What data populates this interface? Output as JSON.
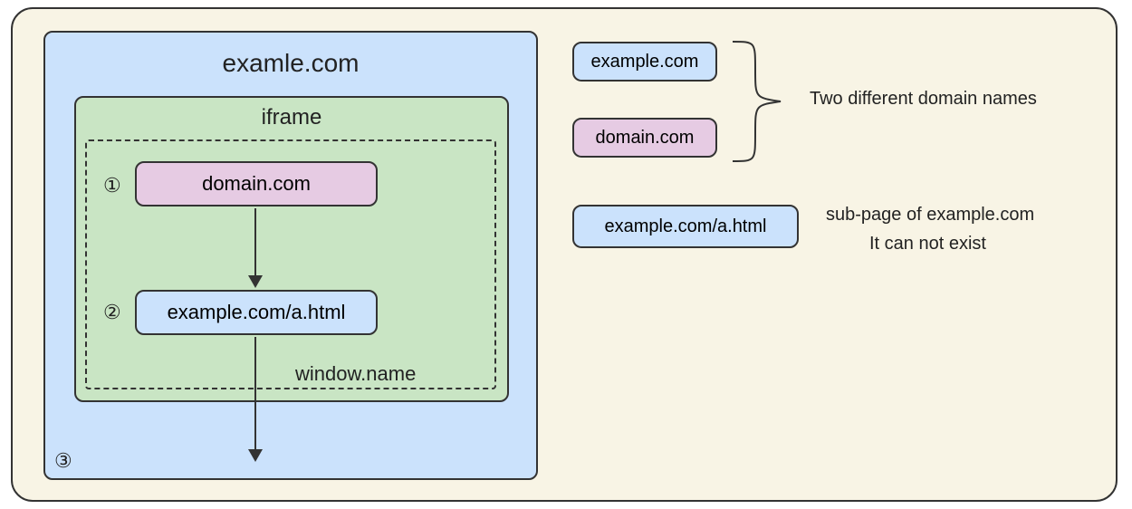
{
  "diagram": {
    "outer_title": "examle.com",
    "iframe_label": "iframe",
    "window_name_label": "window.name",
    "domain_inner": "domain.com",
    "subpage_inner": "example.com/a.html",
    "marker1": "①",
    "marker2": "②",
    "marker3": "③"
  },
  "legend": {
    "example_box": "example.com",
    "domain_box": "domain.com",
    "two_diff_label": "Two different domain names",
    "subpage_box": "example.com/a.html",
    "subpage_desc1": "sub-page of example.com",
    "subpage_desc2": "It can not exist"
  },
  "colors": {
    "background_cream": "#f8f4e5",
    "blue_fill": "#cbe2fc",
    "green_fill": "#c9e5c4",
    "purple_fill": "#e6cbe3",
    "stroke": "#333333"
  }
}
